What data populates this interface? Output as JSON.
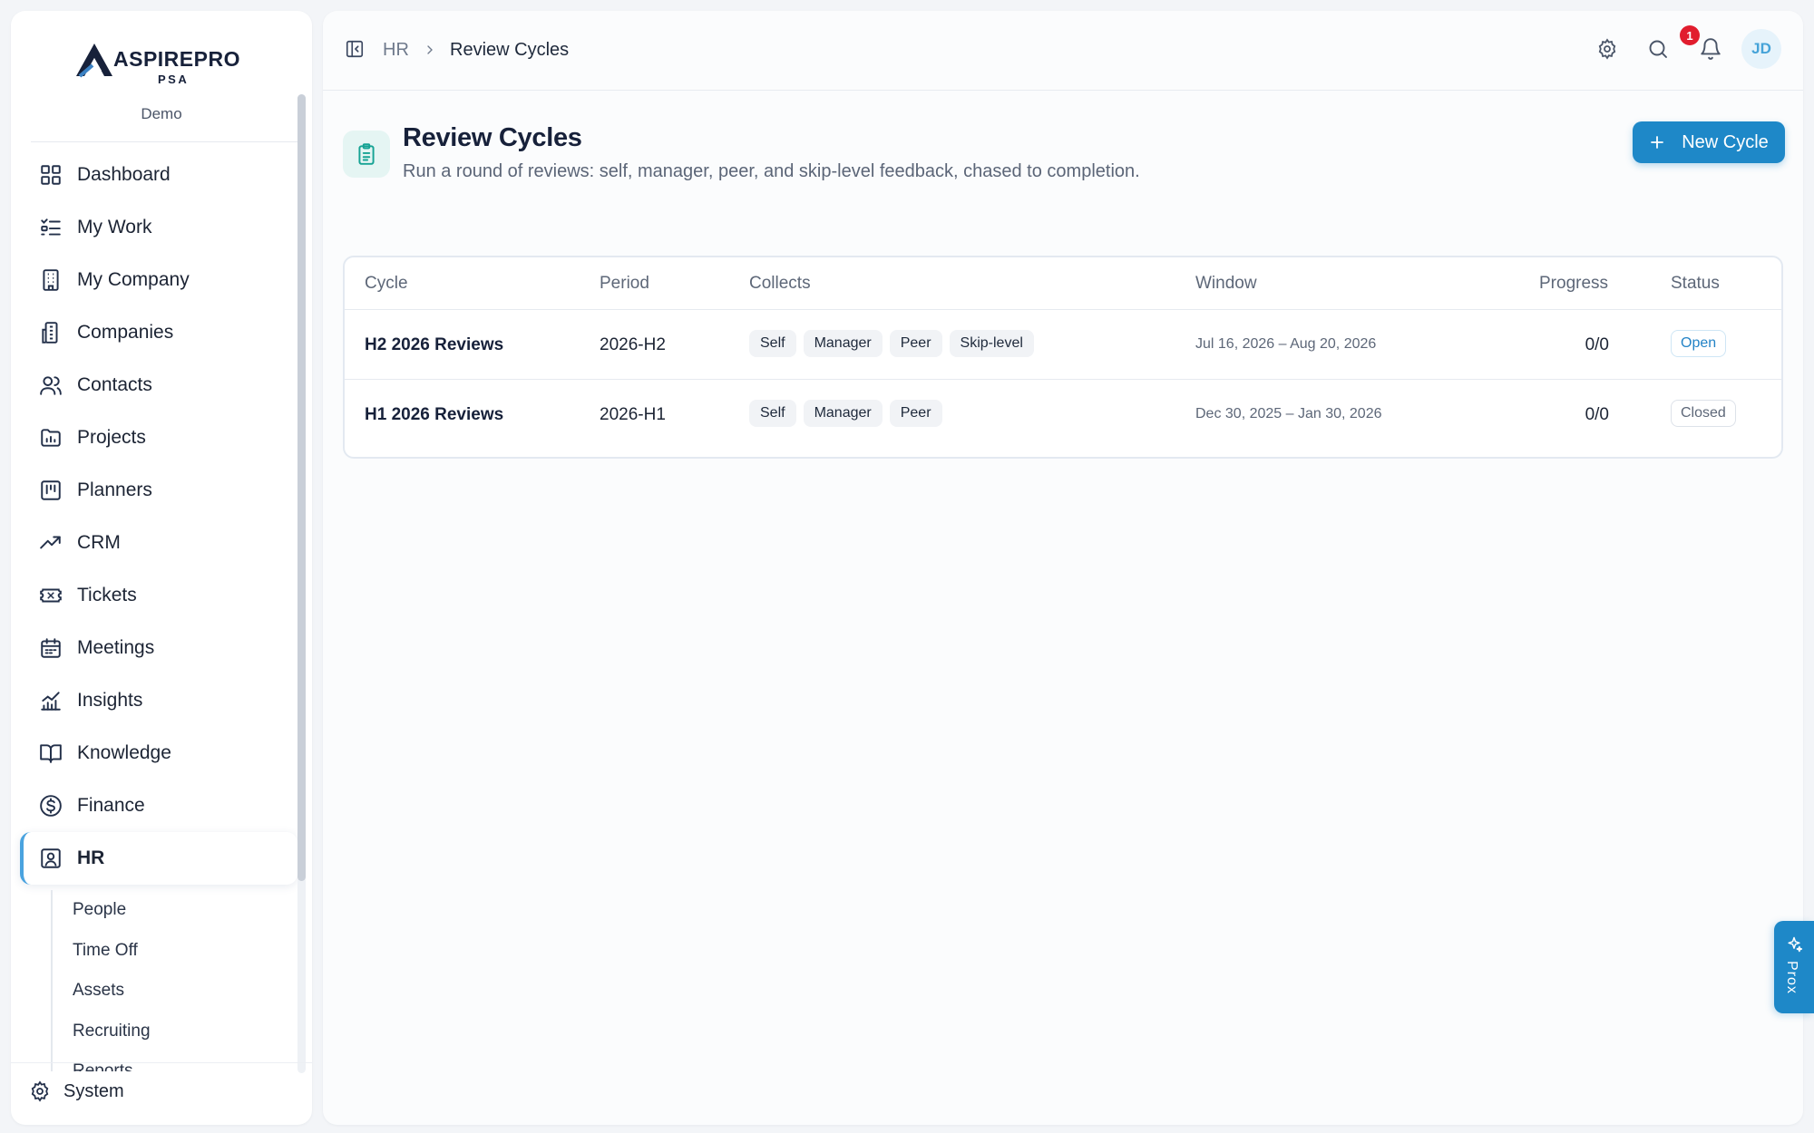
{
  "brand": {
    "name": "ASPIREPRO",
    "sub": "PSA",
    "workspace": "Demo"
  },
  "sidebar": {
    "items": [
      {
        "label": "Dashboard",
        "icon": "dashboard-icon"
      },
      {
        "label": "My Work",
        "icon": "list-check-icon"
      },
      {
        "label": "My Company",
        "icon": "building-icon"
      },
      {
        "label": "Companies",
        "icon": "buildings-icon"
      },
      {
        "label": "Contacts",
        "icon": "users-icon"
      },
      {
        "label": "Projects",
        "icon": "folder-chart-icon"
      },
      {
        "label": "Planners",
        "icon": "kanban-icon"
      },
      {
        "label": "CRM",
        "icon": "trending-up-icon"
      },
      {
        "label": "Tickets",
        "icon": "ticket-icon"
      },
      {
        "label": "Meetings",
        "icon": "calendar-icon"
      },
      {
        "label": "Insights",
        "icon": "bar-chart-icon"
      },
      {
        "label": "Knowledge",
        "icon": "book-open-icon"
      },
      {
        "label": "Finance",
        "icon": "dollar-circle-icon"
      },
      {
        "label": "HR",
        "icon": "contact-badge-icon",
        "active": true
      }
    ],
    "hr_sub_items": [
      "People",
      "Time Off",
      "Assets",
      "Recruiting",
      "Reports"
    ],
    "system_label": "System"
  },
  "topbar": {
    "breadcrumb": {
      "parent": "HR",
      "current": "Review Cycles"
    },
    "notifications_count": "1",
    "avatar_initials": "JD"
  },
  "page": {
    "title": "Review Cycles",
    "subtitle": "Run a round of reviews: self, manager, peer, and skip-level feedback, chased to completion.",
    "new_button_label": "New Cycle"
  },
  "table": {
    "columns": {
      "cycle": "Cycle",
      "period": "Period",
      "collects": "Collects",
      "window": "Window",
      "progress": "Progress",
      "status": "Status"
    },
    "rows": [
      {
        "cycle": "H2 2026 Reviews",
        "period": "2026-H2",
        "collects": [
          "Self",
          "Manager",
          "Peer",
          "Skip-level"
        ],
        "window": "Jul 16, 2026 – Aug 20, 2026",
        "progress": "0/0",
        "status": "Open"
      },
      {
        "cycle": "H1 2026 Reviews",
        "period": "2026-H1",
        "collects": [
          "Self",
          "Manager",
          "Peer"
        ],
        "window": "Dec 30, 2025 – Jan 30, 2026",
        "progress": "0/0",
        "status": "Closed"
      }
    ]
  },
  "assistant": {
    "label": "Prox"
  },
  "colors": {
    "accent": "#1e88c8",
    "teal": "#16a394",
    "badge_red": "#e11d2e"
  }
}
